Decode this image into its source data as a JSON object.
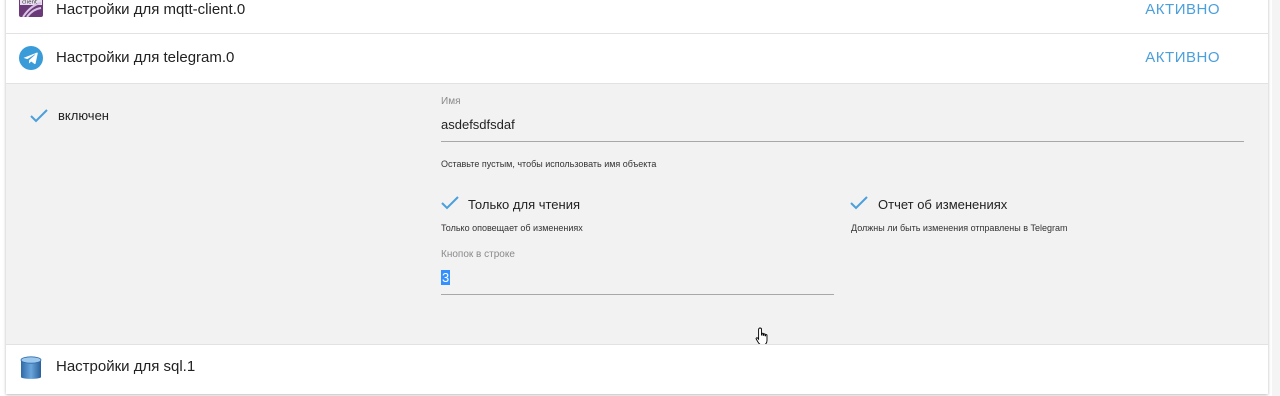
{
  "rows": {
    "mqtt": {
      "title": "Настройки для mqtt-client.0",
      "status": "АКТИВНО",
      "icon": "mqtt-client-icon",
      "icon_text": "client"
    },
    "telegram": {
      "title": "Настройки для telegram.0",
      "status": "АКТИВНО",
      "icon": "telegram-icon"
    },
    "sql": {
      "title": "Настройки для sql.1",
      "icon": "database-icon"
    }
  },
  "telegram_settings": {
    "enabled_label": "включен",
    "name_field": {
      "label": "Имя",
      "value": "asdefsdfsdaf",
      "helper": "Оставьте пустым, чтобы использовать имя объекта"
    },
    "read_only": {
      "label": "Только для чтения",
      "helper": "Только оповещает об изменениях"
    },
    "change_report": {
      "label": "Отчет об изменениях",
      "helper": "Должны ли быть изменения отправлены в Telegram"
    },
    "buttons_per_row": {
      "label": "Кнопок в строке",
      "value": "3"
    }
  },
  "colors": {
    "accent": "#4a9fdc",
    "expanded_bg": "#f2f2f2",
    "selection": "#3390ff"
  }
}
